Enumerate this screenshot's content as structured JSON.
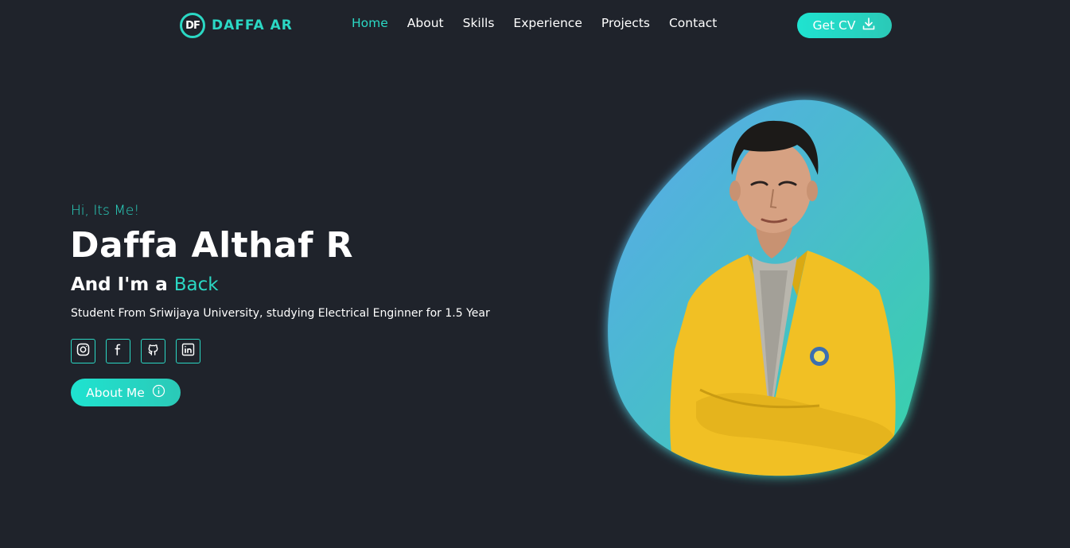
{
  "brand": {
    "logo_text": "DF",
    "name": "DAFFA AR"
  },
  "nav": {
    "items": [
      {
        "label": "Home",
        "active": true
      },
      {
        "label": "About",
        "active": false
      },
      {
        "label": "Skills",
        "active": false
      },
      {
        "label": "Experience",
        "active": false
      },
      {
        "label": "Projects",
        "active": false
      },
      {
        "label": "Contact",
        "active": false
      }
    ],
    "cv_button": {
      "label": "Get CV",
      "icon": "download-icon"
    }
  },
  "hero": {
    "greeting": "Hi, Its Me!",
    "name": "Daffa Althaf R",
    "role_prefix": "And I'm a",
    "role": "Back",
    "description": "Student From Sriwijaya University, studying Electrical Enginner for 1.5 Year",
    "socials": [
      {
        "icon": "instagram-icon"
      },
      {
        "icon": "facebook-icon"
      },
      {
        "icon": "github-icon"
      },
      {
        "icon": "linkedin-icon"
      }
    ],
    "about_button": {
      "label": "About Me",
      "icon": "info-icon"
    }
  },
  "colors": {
    "accent": "#2bd8c4",
    "background": "#1f232b",
    "blob_start": "#5aa8ec",
    "blob_end": "#36d3a8",
    "jacket": "#f1c024"
  }
}
